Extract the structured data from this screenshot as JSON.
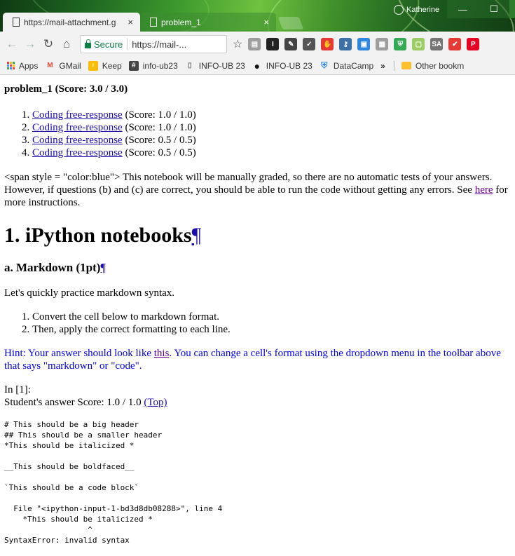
{
  "browser": {
    "user_name": "Katherine",
    "window_controls": {
      "minimize": "—",
      "maximize": "☐"
    },
    "tabs": [
      {
        "title": "https://mail-attachment.g",
        "active": true
      },
      {
        "title": "problem_1",
        "active": false
      }
    ],
    "tab_close_glyph": "×",
    "toolbar": {
      "secure_label": "Secure",
      "url": "https://mail-...",
      "star_glyph": "☆"
    },
    "extensions": [
      {
        "name": "reader-icon",
        "glyph": "▤",
        "color": "#9e9e9e"
      },
      {
        "name": "instapaper-icon",
        "glyph": "I",
        "color": "#222222"
      },
      {
        "name": "evernote-icon",
        "glyph": "✎",
        "color": "#444444"
      },
      {
        "name": "pocket-icon",
        "glyph": "✓",
        "color": "#555555"
      },
      {
        "name": "adblock-icon",
        "glyph": "✋",
        "color": "#e53935"
      },
      {
        "name": "key-icon",
        "glyph": "⚷",
        "color": "#3d6fa8"
      },
      {
        "name": "image-icon",
        "glyph": "▣",
        "color": "#2e86de"
      },
      {
        "name": "table-icon",
        "glyph": "▦",
        "color": "#9e9e9e"
      },
      {
        "name": "shield-icon",
        "glyph": "⛨",
        "color": "#34a853"
      },
      {
        "name": "chat-icon",
        "glyph": "▢",
        "color": "#9ccc65"
      },
      {
        "name": "sa-icon",
        "glyph": "SA",
        "color": "#757575"
      },
      {
        "name": "checkmark-icon",
        "glyph": "✔",
        "color": "#e53935"
      },
      {
        "name": "pinterest-icon",
        "glyph": "P",
        "color": "#e60023"
      }
    ],
    "bookmarks": [
      {
        "name": "apps",
        "label": "Apps"
      },
      {
        "name": "gmail",
        "label": "GMail",
        "glyph": "M",
        "color": "#ea4335"
      },
      {
        "name": "keep",
        "label": "Keep",
        "glyph": "♀",
        "color": "#fbbc04"
      },
      {
        "name": "info-ub23-hash",
        "label": "info-ub23",
        "glyph": "#",
        "color": "#444444"
      },
      {
        "name": "info-ub23-doc",
        "label": "INFO-UB 23",
        "glyph": "▯",
        "color": "#666666"
      },
      {
        "name": "info-ub23-github",
        "label": "INFO-UB 23",
        "glyph": "●",
        "color": "#111111"
      },
      {
        "name": "datacamp",
        "label": "DataCamp",
        "glyph": "⛨",
        "color": "#2e86de"
      }
    ],
    "bookmarks_overflow": "»",
    "other_bookmarks": "Other bookm"
  },
  "page": {
    "problem_title": "problem_1 (Score: 3.0 / 3.0)",
    "score_items": [
      {
        "link": "Coding free-response",
        "score": " (Score: 1.0 / 1.0)"
      },
      {
        "link": "Coding free-response",
        "score": " (Score: 1.0 / 1.0)"
      },
      {
        "link": "Coding free-response",
        "score": " (Score: 0.5 / 0.5)"
      },
      {
        "link": "Coding free-response",
        "score": " (Score: 0.5 / 0.5)"
      }
    ],
    "intro_before": "<span style = \"color:blue\"> This notebook will be manually graded, so there are no automatic tests of your answers. However, if questions (b) and (c) are correct, you should be able to run the code without getting any errors. See ",
    "intro_link": "here",
    "intro_after": " for more instructions.",
    "heading1": "1. iPython notebooks",
    "pilcrow": "¶",
    "heading_a": "a. Markdown (1pt)",
    "practice_text": "Let's quickly practice markdown syntax.",
    "instructions": [
      "Convert the cell below to markdown format.",
      "Then, apply the correct formatting to each line."
    ],
    "hint_before": "Hint: Your answer should look like ",
    "hint_link": "this",
    "hint_after": ". You can change a cell's format using the dropdown menu in the toolbar above that says \"markdown\" or \"code\".",
    "in_label": "In [1]:",
    "student_answer": "Student's answer Score: 1.0 / 1.0 ",
    "top_link": "(Top)",
    "code": "# This should be a big header\n## This should be a smaller header\n*This should be italicized *\n\n__This should be boldfaced__\n\n`This should be a code block`\n\n  File \"<ipython-input-1-bd3d8db08288>\", line 4\n    *This should be italicized *\n                  ^\nSyntaxError: invalid syntax"
  }
}
